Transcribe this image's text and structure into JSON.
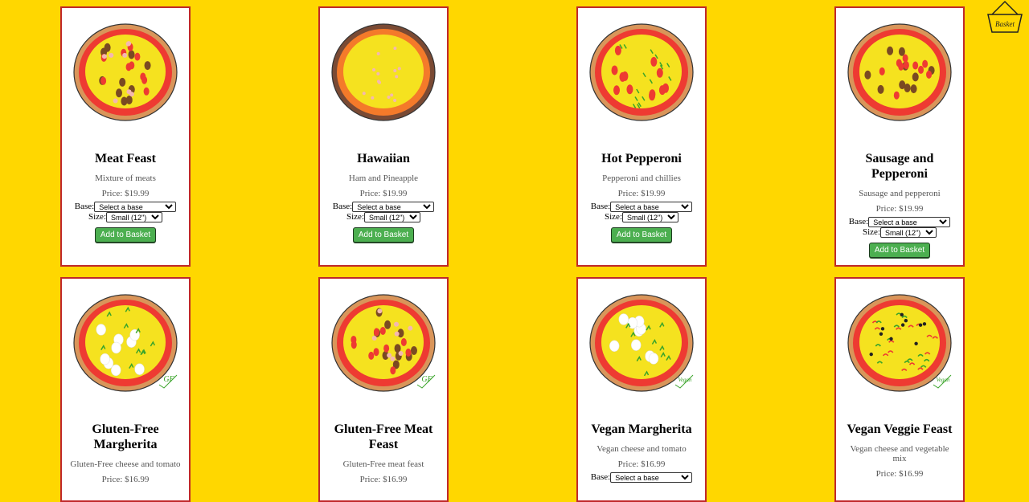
{
  "basket": {
    "label": "Basket"
  },
  "options": {
    "base_label": "Base:",
    "size_label": "Size:",
    "base_default": "Select a base",
    "size_default": "Small (12\")",
    "add_label": "Add to Basket"
  },
  "pizzas": [
    {
      "name": "Meat Feast",
      "desc": "Mixture of meats",
      "price": "Price: $19.99",
      "topping": "meat"
    },
    {
      "name": "Hawaiian",
      "desc": "Ham and Pineapple",
      "price": "Price: $19.99",
      "topping": "hawaiian"
    },
    {
      "name": "Hot Pepperoni",
      "desc": "Pepperoni and chillies",
      "price": "Price: $19.99",
      "topping": "pepperoni"
    },
    {
      "name": "Sausage and Pepperoni",
      "desc": "Sausage and pepperoni",
      "price": "Price: $19.99",
      "topping": "sausage"
    },
    {
      "name": "Gluten-Free Margherita",
      "desc": "Gluten-Free cheese and tomato",
      "price": "Price: $16.99",
      "topping": "margherita",
      "mark": "GF"
    },
    {
      "name": "Gluten-Free Meat Feast",
      "desc": "Gluten-Free meat feast",
      "price": "Price: $16.99",
      "topping": "meat",
      "mark": "GF"
    },
    {
      "name": "Vegan Margherita",
      "desc": "Vegan cheese and tomato",
      "price": "Price: $16.99",
      "topping": "margherita",
      "mark": "Vegan"
    },
    {
      "name": "Vegan Veggie Feast",
      "desc": "Vegan cheese and vegetable mix",
      "price": "Price: $16.99",
      "topping": "veggie",
      "mark": "Vegan"
    }
  ]
}
